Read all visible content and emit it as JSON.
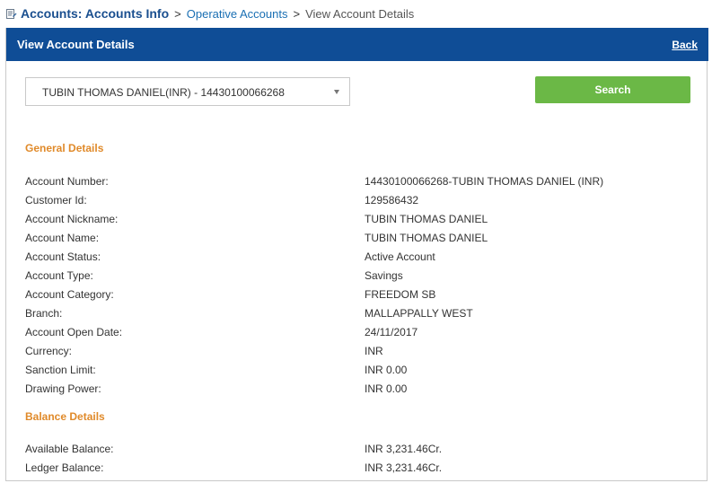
{
  "breadcrumb": {
    "root": "Accounts: Accounts Info",
    "separator": ">",
    "middle": "Operative Accounts",
    "current": "View Account Details"
  },
  "panel": {
    "title": "View Account Details",
    "back_label": "Back"
  },
  "account_select": {
    "selected_value": "TUBIN THOMAS DANIEL(INR) - 14430100066268"
  },
  "search_button": {
    "label": "Search"
  },
  "general_details": {
    "title": "General Details",
    "rows": [
      {
        "label": "Account Number:",
        "value": "14430100066268-TUBIN THOMAS DANIEL (INR)"
      },
      {
        "label": "Customer Id:",
        "value": "129586432"
      },
      {
        "label": "Account Nickname:",
        "value": "TUBIN THOMAS DANIEL"
      },
      {
        "label": "Account Name:",
        "value": "TUBIN THOMAS DANIEL"
      },
      {
        "label": "Account Status:",
        "value": "Active Account"
      },
      {
        "label": "Account Type:",
        "value": "Savings"
      },
      {
        "label": "Account Category:",
        "value": "FREEDOM SB"
      },
      {
        "label": "Branch:",
        "value": "MALLAPPALLY WEST"
      },
      {
        "label": "Account Open Date:",
        "value": "24/11/2017"
      },
      {
        "label": "Currency:",
        "value": "INR"
      },
      {
        "label": "Sanction Limit:",
        "value": "INR 0.00"
      },
      {
        "label": "Drawing Power:",
        "value": "INR 0.00"
      }
    ]
  },
  "balance_details": {
    "title": "Balance Details",
    "rows": [
      {
        "label": "Available Balance:",
        "value": "INR 3,231.46Cr."
      },
      {
        "label": "Ledger Balance:",
        "value": "INR 3,231.46Cr."
      }
    ]
  },
  "colors": {
    "header_bg": "#0f4d96",
    "section_title": "#e08a2a",
    "search_button": "#6bb846",
    "breadcrumb_link": "#1a6fb3"
  }
}
